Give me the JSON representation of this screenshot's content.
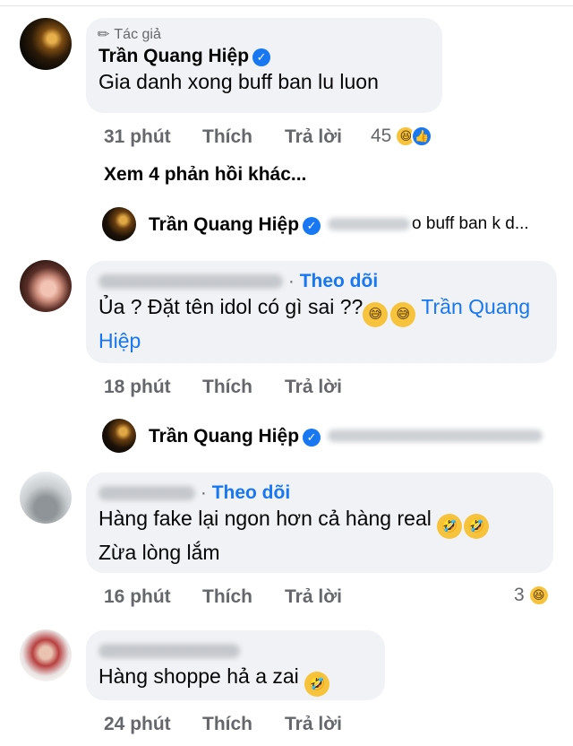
{
  "comment1": {
    "author_tag": "Tác giả",
    "name": "Trần Quang Hiệp",
    "text": "Gia danh xong buff ban lu luon",
    "time": "31 phút",
    "like": "Thích",
    "reply": "Trả lời",
    "react_count": "45"
  },
  "more_replies": "Xem 4 phản hồi khác...",
  "reply1": {
    "name": "Trần Quang Hiệp",
    "text": "o buff ban k d..."
  },
  "comment2": {
    "follow": "Theo dõi",
    "text": "Ủa ? Đặt tên idol có gì sai ??",
    "mention": "Trần Quang Hiệp",
    "time": "18 phút",
    "like": "Thích",
    "reply": "Trả lời"
  },
  "reply2": {
    "name": "Trần Quang Hiệp"
  },
  "comment3": {
    "follow": "Theo dõi",
    "line1": "Hàng fake lại ngon hơn cả hàng real",
    "line2": "Zừa lòng lắm",
    "time": "16 phút",
    "like": "Thích",
    "reply": "Trả lời",
    "react_count": "3"
  },
  "comment4": {
    "text": "Hàng shoppe hả a zai",
    "time": "24 phút",
    "like": "Thích",
    "reply": "Trả lời"
  },
  "icons": {
    "pen": "pen-icon",
    "verified": "verified-badge-icon",
    "haha": "haha-emoji-icon",
    "like": "like-icon",
    "rofl": "rofl-emoji-icon"
  },
  "colors": {
    "accent": "#1877f2",
    "bubble": "#f0f2f5",
    "meta": "#65676b"
  }
}
